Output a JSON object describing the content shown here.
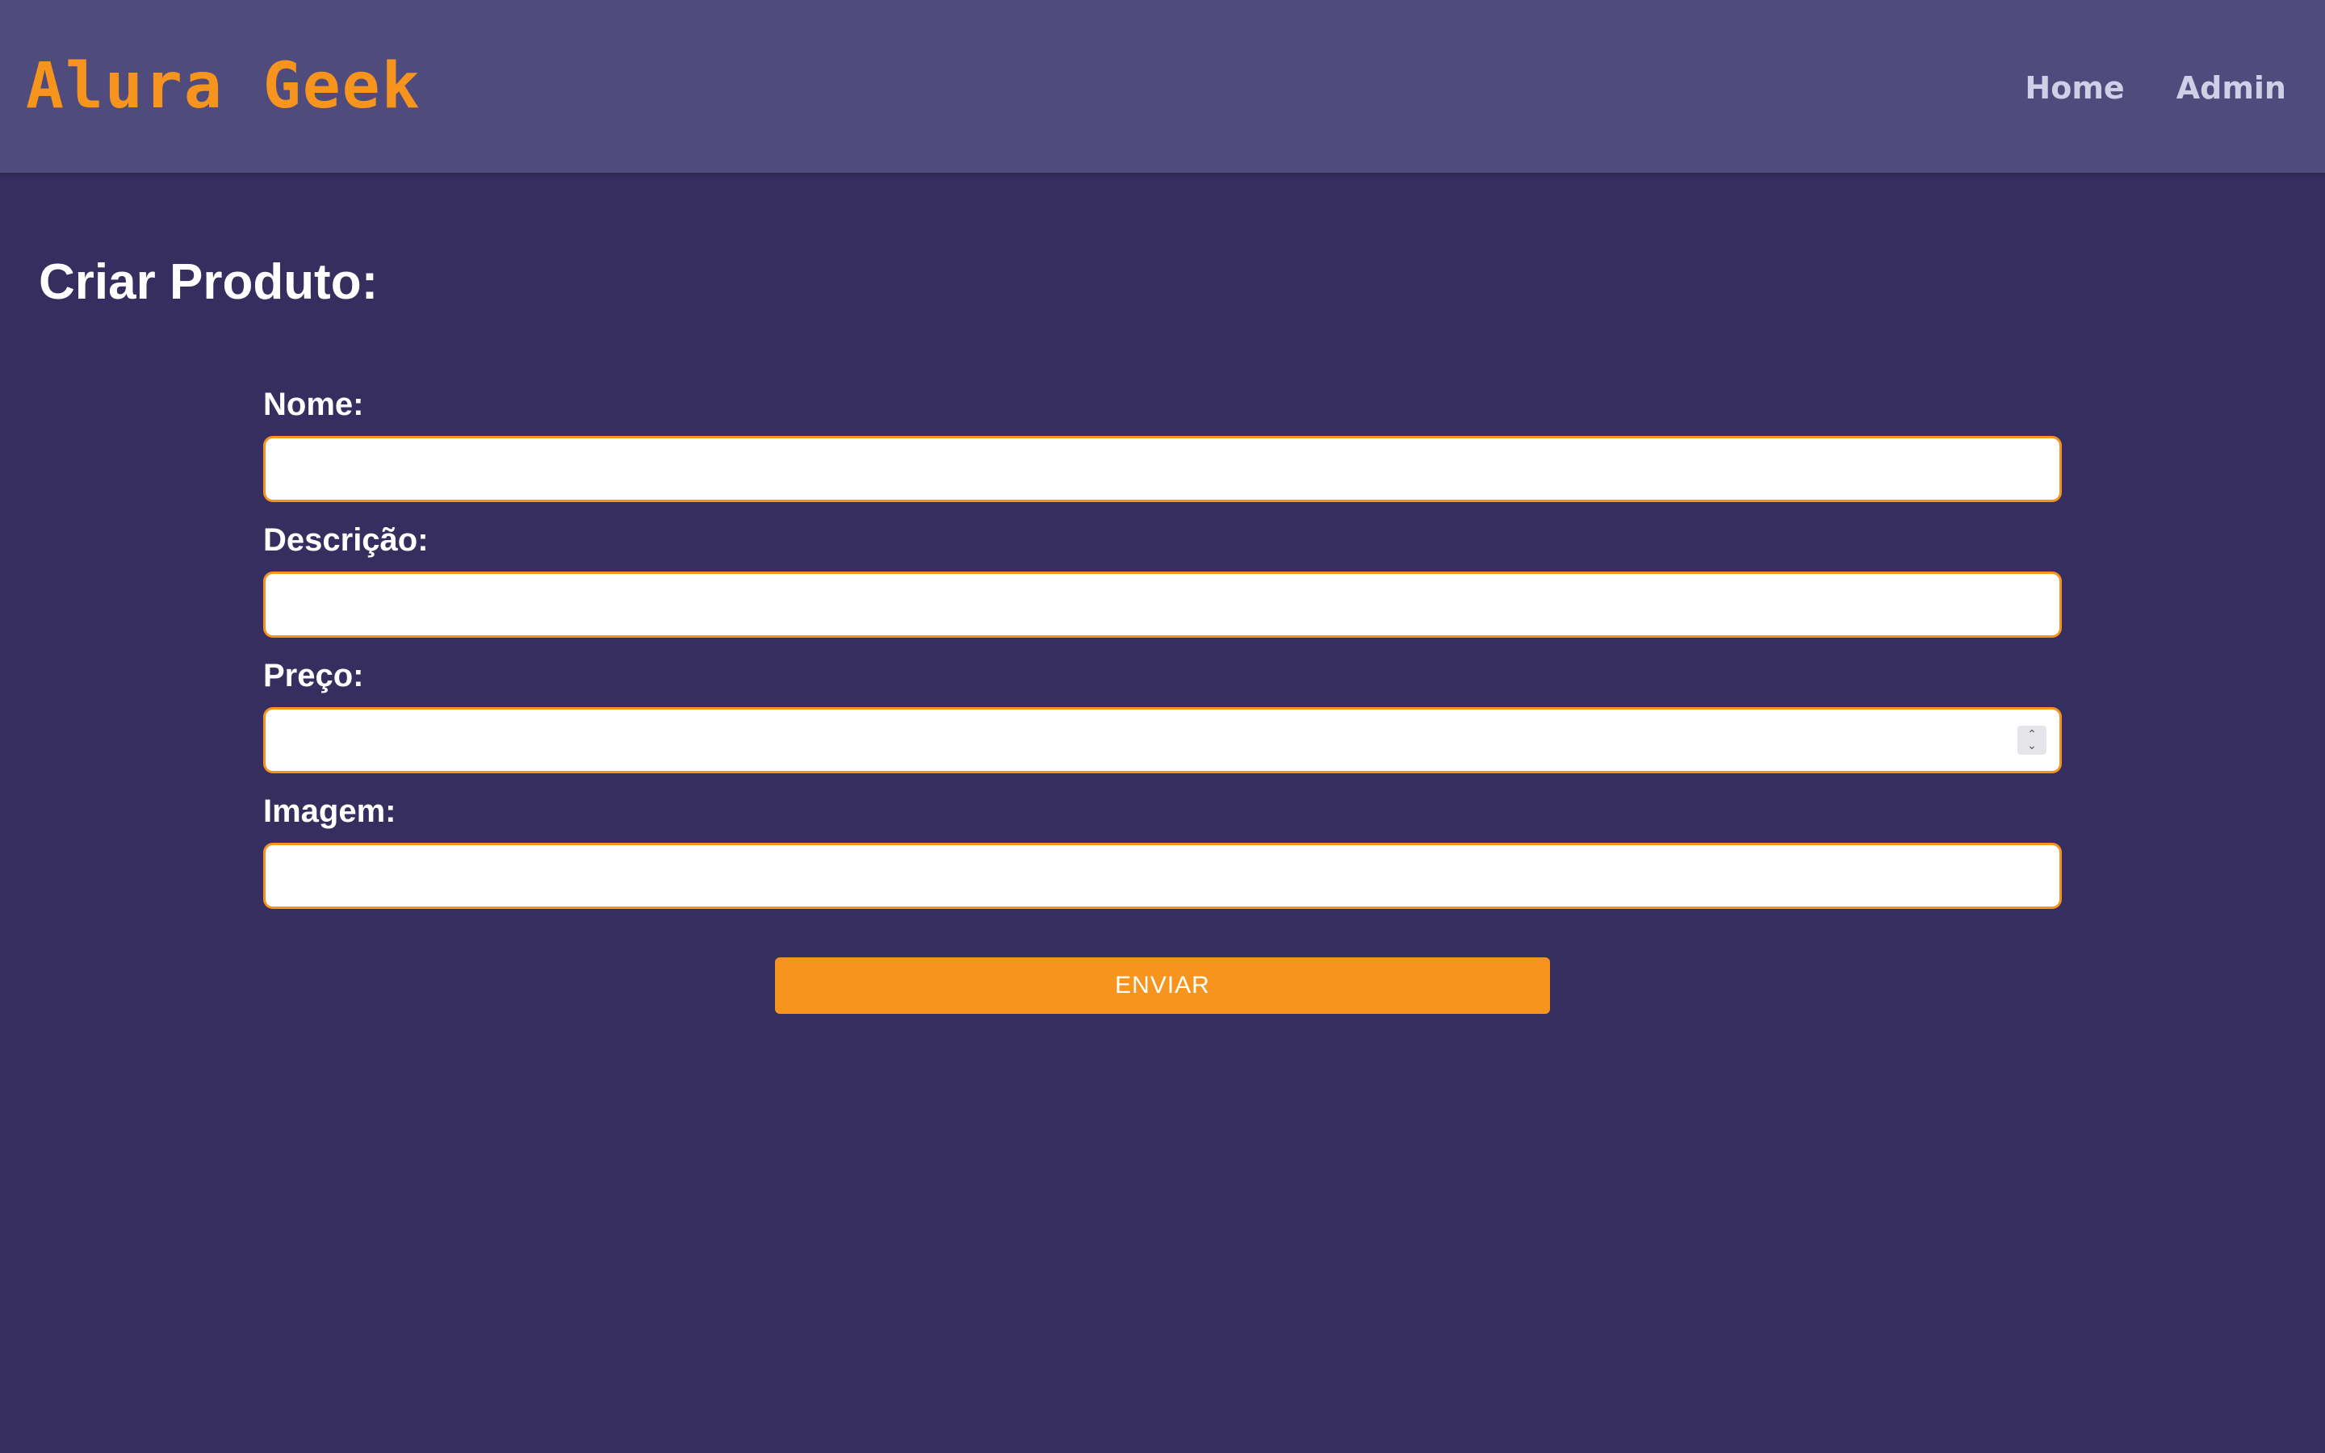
{
  "header": {
    "logo": "Alura Geek",
    "nav": [
      {
        "label": "Home"
      },
      {
        "label": "Admin"
      }
    ]
  },
  "main": {
    "title": "Criar Produto:",
    "fields": [
      {
        "label": "Nome:",
        "value": "",
        "type": "text"
      },
      {
        "label": "Descrição:",
        "value": "",
        "type": "text"
      },
      {
        "label": "Preço:",
        "value": "",
        "type": "number"
      },
      {
        "label": "Imagem:",
        "value": "",
        "type": "text"
      }
    ],
    "submit_label": "ENVIAR"
  },
  "colors": {
    "background": "#352e5f",
    "header": "#4f4c7d",
    "accent": "#f7941d",
    "nav_text": "#cfd0e8"
  }
}
